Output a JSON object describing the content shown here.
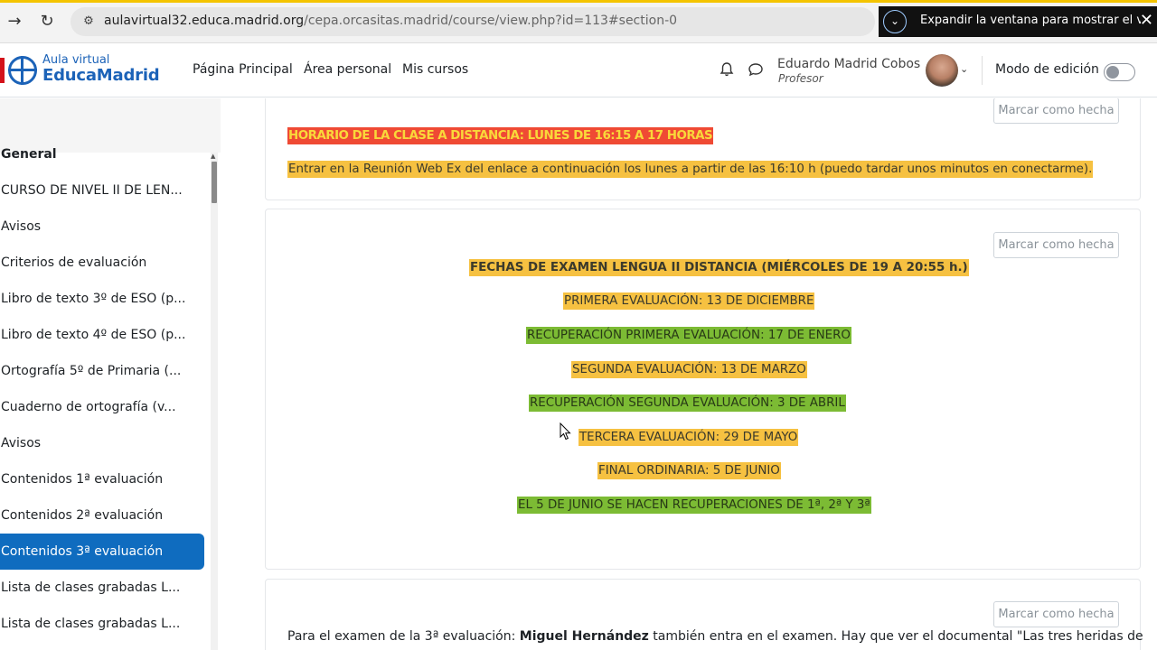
{
  "browser": {
    "url_host": "aulavirtual32.educa.madrid.org",
    "url_path": "/cepa.orcasitas.madrid/course/view.php?id=113#section-0",
    "pip_banner": "Expandir la ventana para mostrar el víde"
  },
  "navbar": {
    "logo_line1": "Aula virtual",
    "logo_line2": "EducaMadrid",
    "links": [
      "Página Principal",
      "Área personal",
      "Mis cursos"
    ],
    "user_name": "Eduardo Madrid Cobos",
    "user_role": "Profesor",
    "edit_mode_label": "Modo de edición",
    "edit_mode_on": false
  },
  "sidebar": {
    "items": [
      {
        "label": "General"
      },
      {
        "label": "CURSO DE NIVEL II DE LEN..."
      },
      {
        "label": "Avisos"
      },
      {
        "label": "Criterios de evaluación"
      },
      {
        "label": "Libro de texto 3º de ESO (p..."
      },
      {
        "label": "Libro de texto 4º de ESO (p..."
      },
      {
        "label": "Ortografía 5º de Primaria (..."
      },
      {
        "label": "Cuaderno de ortografía (v..."
      },
      {
        "label": "Avisos"
      },
      {
        "label": "Contenidos 1ª evaluación"
      },
      {
        "label": "Contenidos 2ª evaluación"
      },
      {
        "label": "Contenidos 3ª evaluación",
        "active": true
      },
      {
        "label": "Lista de clases grabadas L..."
      },
      {
        "label": "Lista de clases grabadas L..."
      }
    ]
  },
  "main": {
    "mark_done_label": "Marcar como hecha",
    "card1": {
      "schedule": "HORARIO DE LA CLASE A DISTANCIA: LUNES DE 16:15 A 17 HORAS",
      "join_text": "Entrar en la Reunión Web Ex del enlace a continuación los lunes a partir de las 16:10 h (puedo tardar unos minutos en conectarme)."
    },
    "card2": {
      "heading": "FECHAS DE EXAMEN LENGUA II DISTANCIA (MIÉRCOLES DE 19 A 20:55 h.)",
      "lines": [
        "PRIMERA EVALUACIÓN: 13 DE DICIEMBRE",
        "RECUPERACIÓN PRIMERA EVALUACIÓN: 17 DE ENERO",
        "SEGUNDA EVALUACIÓN: 13 DE MARZO",
        "RECUPERACIÓN SEGUNDA EVALUACIÓN:  3 DE ABRIL",
        "TERCERA EVALUACIÓN: 29 DE MAYO",
        "FINAL ORDINARIA: 5 DE JUNIO",
        "EL 5 DE JUNIO SE HACEN RECUPERACIONES DE 1ª, 2ª Y 3ª"
      ]
    },
    "card3": {
      "text_before": "Para el examen de la 3ª evaluación: ",
      "text_bold": "Miguel Hernández",
      "text_after": " también entra en el examen. Hay que ver el documental \"Las tres heridas de"
    }
  },
  "colors": {
    "accent": "#0f6cbf",
    "highlight_orange": "#f6c141",
    "highlight_green": "#7cbb34",
    "highlight_red": "#ef4a34"
  }
}
